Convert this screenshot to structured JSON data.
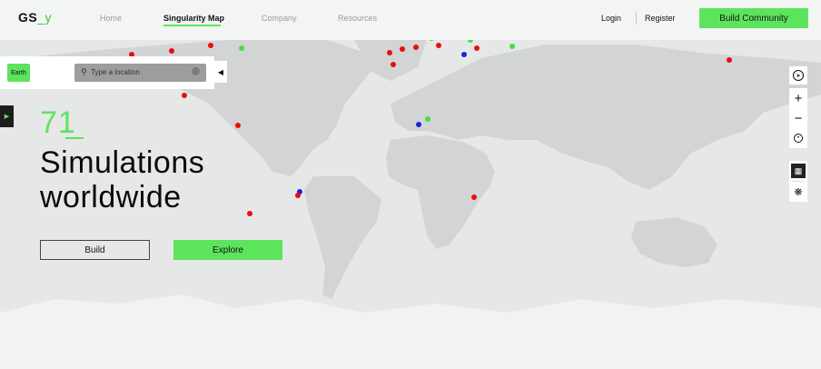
{
  "header": {
    "logo_text": "GS",
    "logo_accent": "_y",
    "nav": [
      {
        "label": "Home",
        "active": false
      },
      {
        "label": "Singularity Map",
        "active": true
      },
      {
        "label": "Company",
        "active": false
      },
      {
        "label": "Resources",
        "active": false
      }
    ],
    "login_label": "Login",
    "register_label": "Register",
    "cta_label": "Build Community"
  },
  "search_panel": {
    "scope_chip": "Earth",
    "search_placeholder": "Type a location",
    "collapse_icon": "chevron-left-icon",
    "side_tab_icon": "chevron-right-icon"
  },
  "hero": {
    "count": "71",
    "title": "Simulations worldwide",
    "build_label": "Build",
    "explore_label": "Explore"
  },
  "map_controls": {
    "compass_icon": "compass-icon",
    "zoom_in_label": "+",
    "zoom_out_label": "−",
    "locate_icon": "locate-icon",
    "layer_icon": "chart-layer-icon",
    "network_icon": "network-icon"
  },
  "colors": {
    "accent": "#5de45d",
    "marker_red": "#e60f0f",
    "marker_green": "#3fe13f",
    "marker_blue": "#1528d8",
    "land": "#d2d4d5",
    "ocean": "#e6e7e7"
  },
  "markers": [
    {
      "lon": -122.4,
      "lat": 37.8,
      "status": "red"
    },
    {
      "lon": -118.2,
      "lat": 34.1,
      "status": "red"
    },
    {
      "lon": -87.6,
      "lat": 41.9,
      "status": "red"
    },
    {
      "lon": -95.4,
      "lat": 29.8,
      "status": "red"
    },
    {
      "lon": -104.9,
      "lat": 39.7,
      "status": "red"
    },
    {
      "lon": -97.7,
      "lat": 30.3,
      "status": "red"
    },
    {
      "lon": -112.0,
      "lat": 33.4,
      "status": "green"
    },
    {
      "lon": -110.0,
      "lat": 32.2,
      "status": "green"
    },
    {
      "lon": -74.0,
      "lat": 40.7,
      "status": "green"
    },
    {
      "lon": -99.1,
      "lat": 19.4,
      "status": "red"
    },
    {
      "lon": -75.5,
      "lat": 6.2,
      "status": "red"
    },
    {
      "lon": -48.5,
      "lat": -23.5,
      "status": "blue"
    },
    {
      "lon": -49.3,
      "lat": -25.4,
      "status": "red"
    },
    {
      "lon": -70.6,
      "lat": -33.4,
      "status": "red"
    },
    {
      "lon": -0.1,
      "lat": 51.5,
      "status": "red"
    },
    {
      "lon": 2.3,
      "lat": 48.9,
      "status": "red"
    },
    {
      "lon": 4.9,
      "lat": 52.4,
      "status": "red"
    },
    {
      "lon": 13.4,
      "lat": 52.5,
      "status": "red"
    },
    {
      "lon": 8.7,
      "lat": 50.1,
      "status": "red"
    },
    {
      "lon": 10.0,
      "lat": 53.6,
      "status": "red"
    },
    {
      "lon": 11.6,
      "lat": 48.1,
      "status": "red"
    },
    {
      "lon": 16.4,
      "lat": 48.2,
      "status": "blue"
    },
    {
      "lon": 14.4,
      "lat": 50.1,
      "status": "blue"
    },
    {
      "lon": 21.0,
      "lat": 52.2,
      "status": "blue"
    },
    {
      "lon": 9.2,
      "lat": 45.5,
      "status": "green"
    },
    {
      "lon": 12.5,
      "lat": 41.9,
      "status": "red"
    },
    {
      "lon": 19.0,
      "lat": 47.5,
      "status": "green"
    },
    {
      "lon": 2.2,
      "lat": 41.4,
      "status": "red"
    },
    {
      "lon": -3.7,
      "lat": 40.4,
      "status": "red"
    },
    {
      "lon": -9.1,
      "lat": 38.7,
      "status": "red"
    },
    {
      "lon": 23.7,
      "lat": 38.0,
      "status": "blue"
    },
    {
      "lon": 26.1,
      "lat": 44.4,
      "status": "green"
    },
    {
      "lon": 28.9,
      "lat": 41.0,
      "status": "red"
    },
    {
      "lon": 44.8,
      "lat": 41.7,
      "status": "green"
    },
    {
      "lon": 18.1,
      "lat": 59.3,
      "status": "red"
    },
    {
      "lon": 10.7,
      "lat": 59.9,
      "status": "red"
    },
    {
      "lon": 12.6,
      "lat": 55.7,
      "status": "red"
    },
    {
      "lon": -21.9,
      "lat": 64.1,
      "status": "blue"
    },
    {
      "lon": 7.4,
      "lat": 46.9,
      "status": "red"
    },
    {
      "lon": -7.6,
      "lat": 33.6,
      "status": "red"
    },
    {
      "lon": 3.4,
      "lat": 6.5,
      "status": "blue"
    },
    {
      "lon": 7.5,
      "lat": 9.1,
      "status": "green"
    },
    {
      "lon": 28.0,
      "lat": -26.2,
      "status": "red"
    },
    {
      "lon": 139.7,
      "lat": 35.7,
      "status": "red"
    }
  ]
}
